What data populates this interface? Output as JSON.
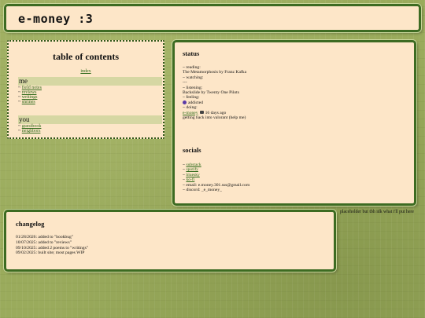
{
  "header": {
    "title": "e-money :3"
  },
  "toc": {
    "title": "table of contents",
    "index": "index",
    "me": {
      "heading": "me",
      "items": [
        "field notes",
        "reviews",
        "writings",
        "shrines"
      ]
    },
    "you": {
      "heading": "you",
      "items": [
        "guestbook",
        "neighbors"
      ]
    }
  },
  "status": {
    "title": "status",
    "reading_label": "~ reading:",
    "reading_value": "The Metamorphosis by Franz Kafka",
    "watching_label": "~ watching:",
    "watching_value": "---",
    "listening_label": "~ listening:",
    "listening_value": "Backslide by Twenty One Pilots",
    "feeling_label": "~ feeling:",
    "feeling_icon": "purple-circle-icon",
    "feeling_value": "addicted",
    "doing_label": "~ doing:",
    "doing_user": "e-money",
    "doing_time": "16 days ago",
    "doing_value": "getting back into valorant (help me)"
  },
  "socials": {
    "title": "socials",
    "prefix": "~",
    "items": [
      "substack",
      "spotify",
      "bluesky",
      "ko-fi"
    ],
    "email": "~ email: e.money.301.sss@gmail.com",
    "discord": "~ discord: _e_money_"
  },
  "changelog": {
    "title": "changelog",
    "entries": [
      "01/28/2026: added to \"bookbug\"",
      "10/07/2025: added to \"reviews\"",
      "09/10/2025: added 2 poems to \"writings\"",
      "09/02/2025: built site; most pages WIP"
    ]
  },
  "aside": {
    "text": "placeholder but tbh idk what i'll put here"
  },
  "colors": {
    "background": "#9aab5c",
    "panel": "#fde6c8",
    "border": "#3d6b22",
    "link": "#2f6a1a"
  }
}
